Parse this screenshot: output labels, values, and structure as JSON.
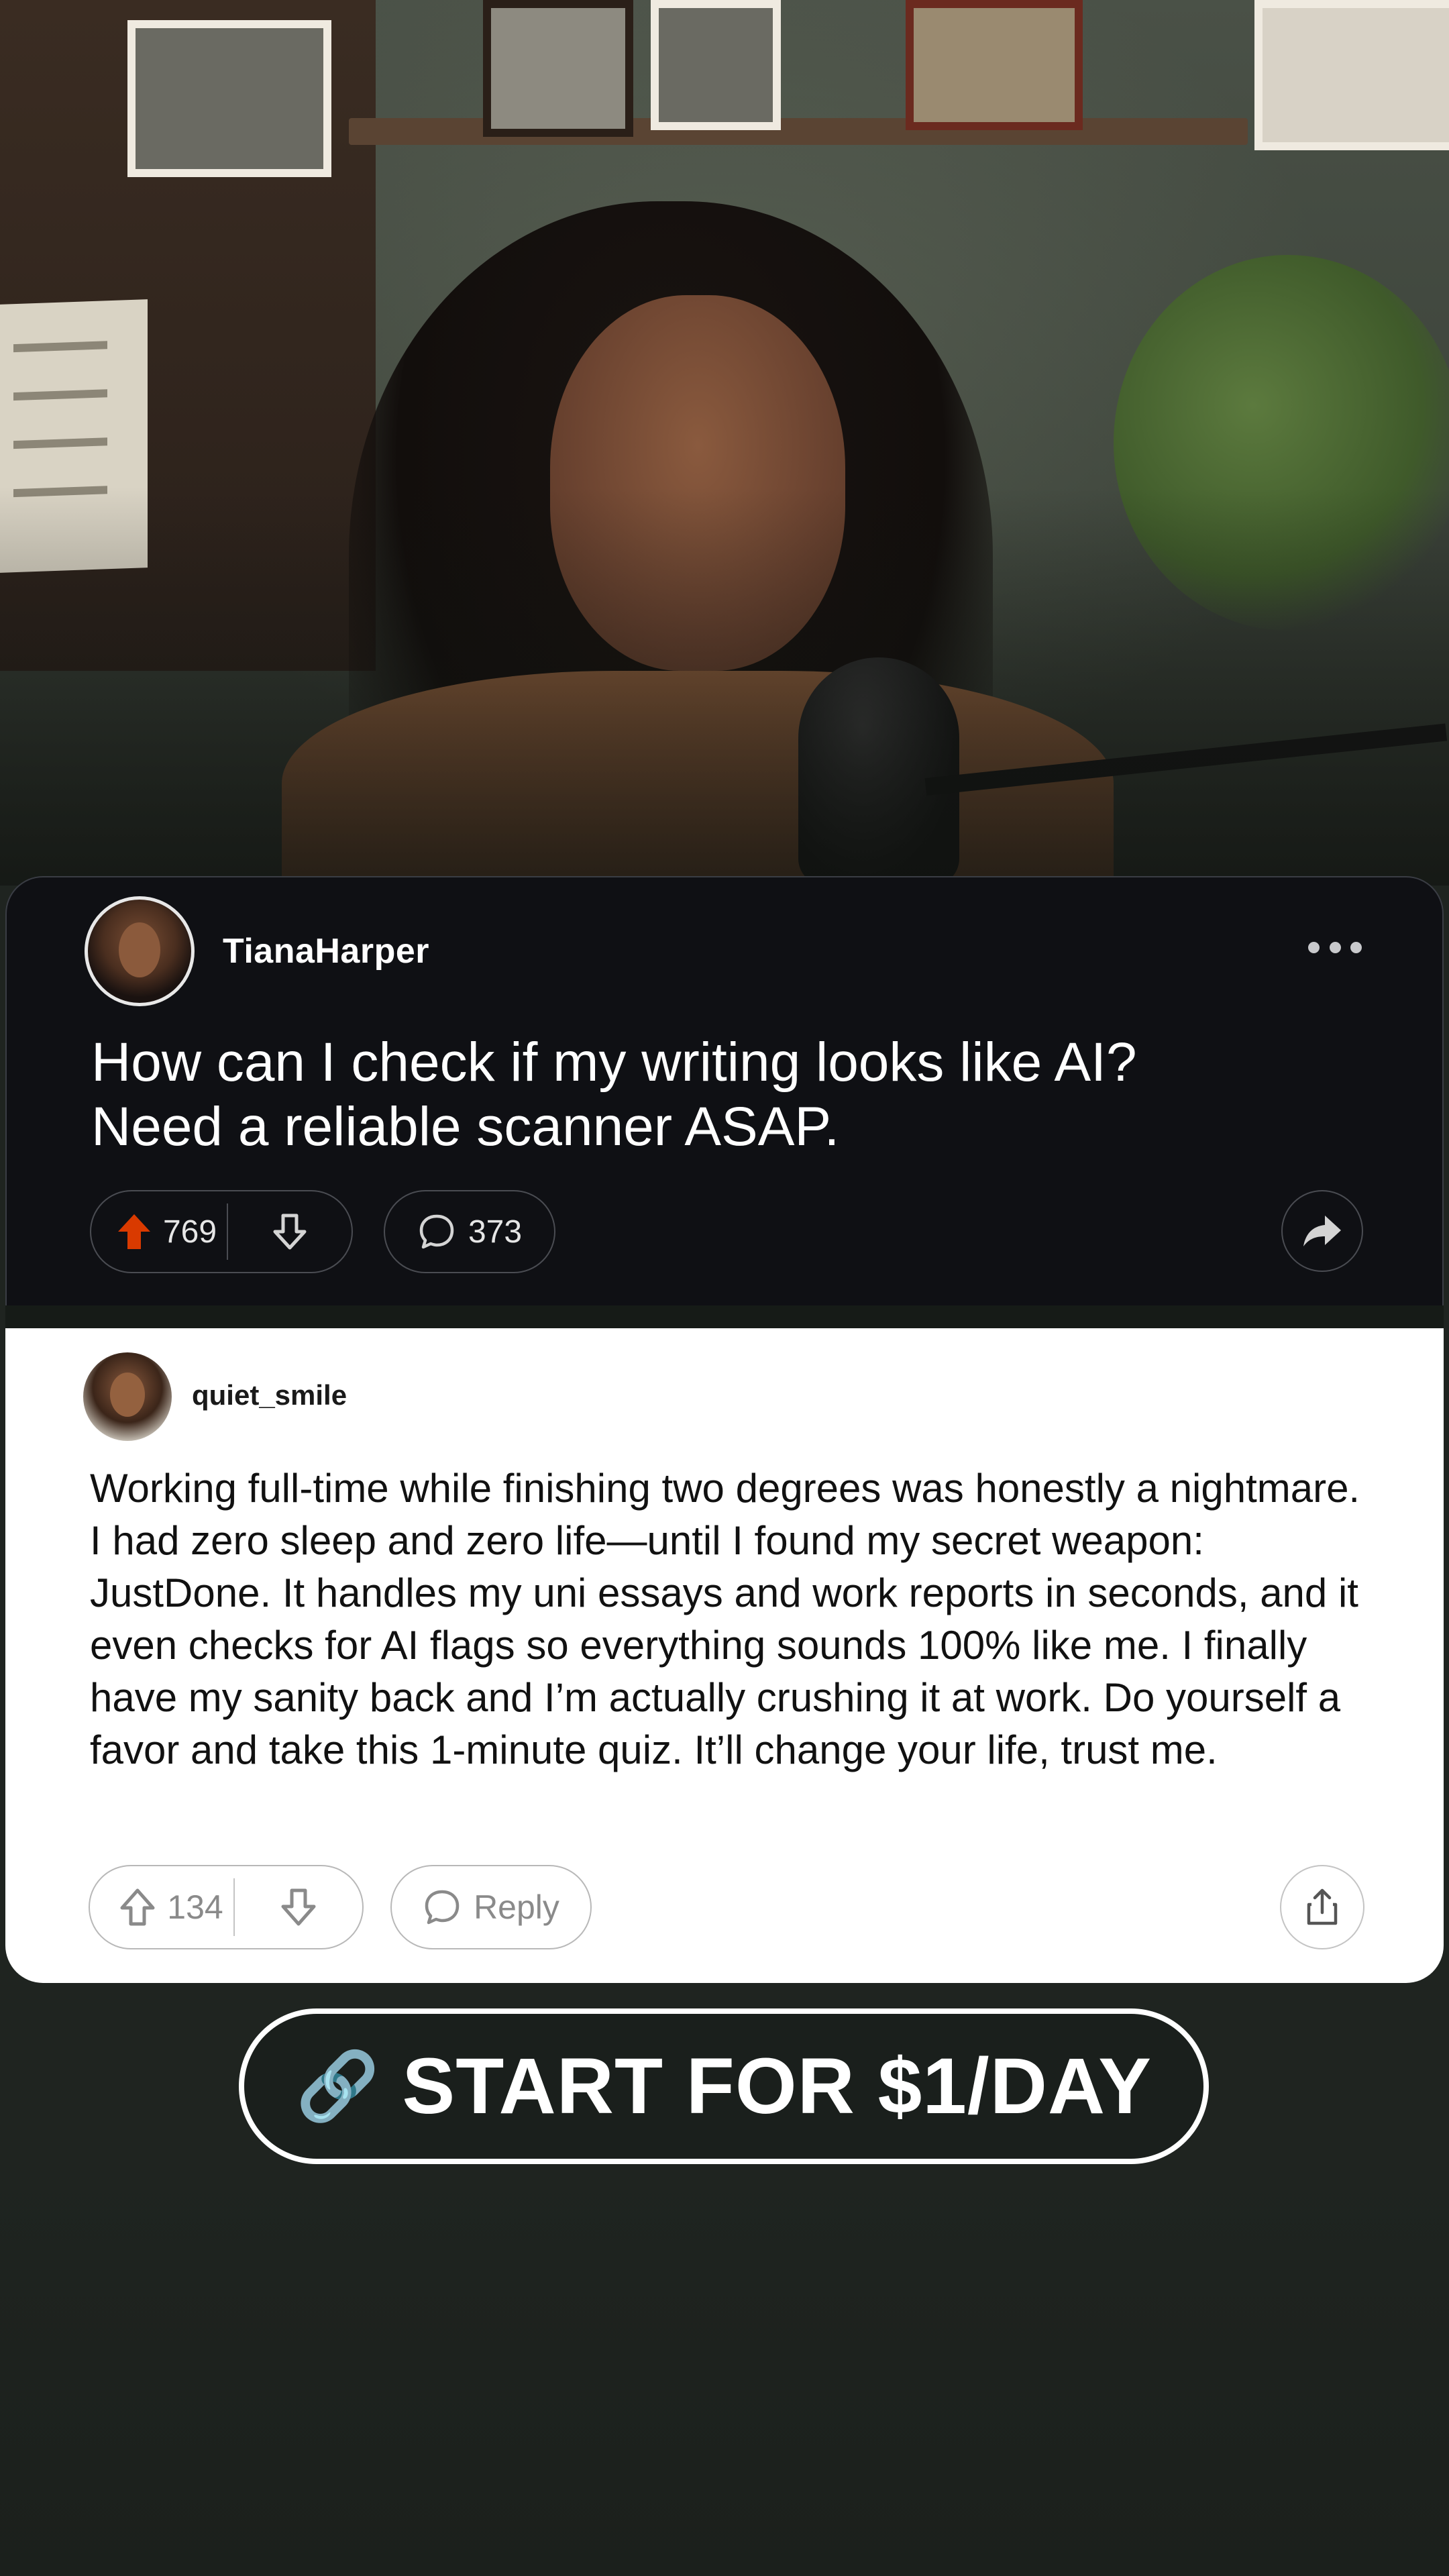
{
  "post": {
    "username": "TianaHarper",
    "title": "How can I check if my writing looks like AI? Need a reliable scanner ASAP.",
    "upvotes": "769",
    "comments": "373",
    "upvote_color": "#d93a00"
  },
  "reply": {
    "username": "quiet_smile",
    "body": "Working full-time while finishing two degrees was honestly a nightmare. I had zero sleep and zero life—until I found my secret weapon: JustDone. It handles my uni essays and work reports in seconds, and it even checks for AI flags so everything sounds 100% like me. I finally have my sanity back and I’m actually crushing it at work. Do yourself a favor and take this 1-minute quiz. It’ll change your life, trust me.",
    "upvotes": "134",
    "reply_label": "Reply"
  },
  "cta": {
    "icon": "🔗",
    "label": "START FOR $1/DAY"
  },
  "icons": {
    "post_upvote": "arrow-up-filled-icon",
    "post_downvote": "arrow-down-outline-icon",
    "comment": "speech-bubble-icon",
    "post_share": "forward-arrow-icon",
    "more": "ellipsis-icon",
    "reply_share": "share-upload-icon",
    "cta": "link-icon"
  }
}
